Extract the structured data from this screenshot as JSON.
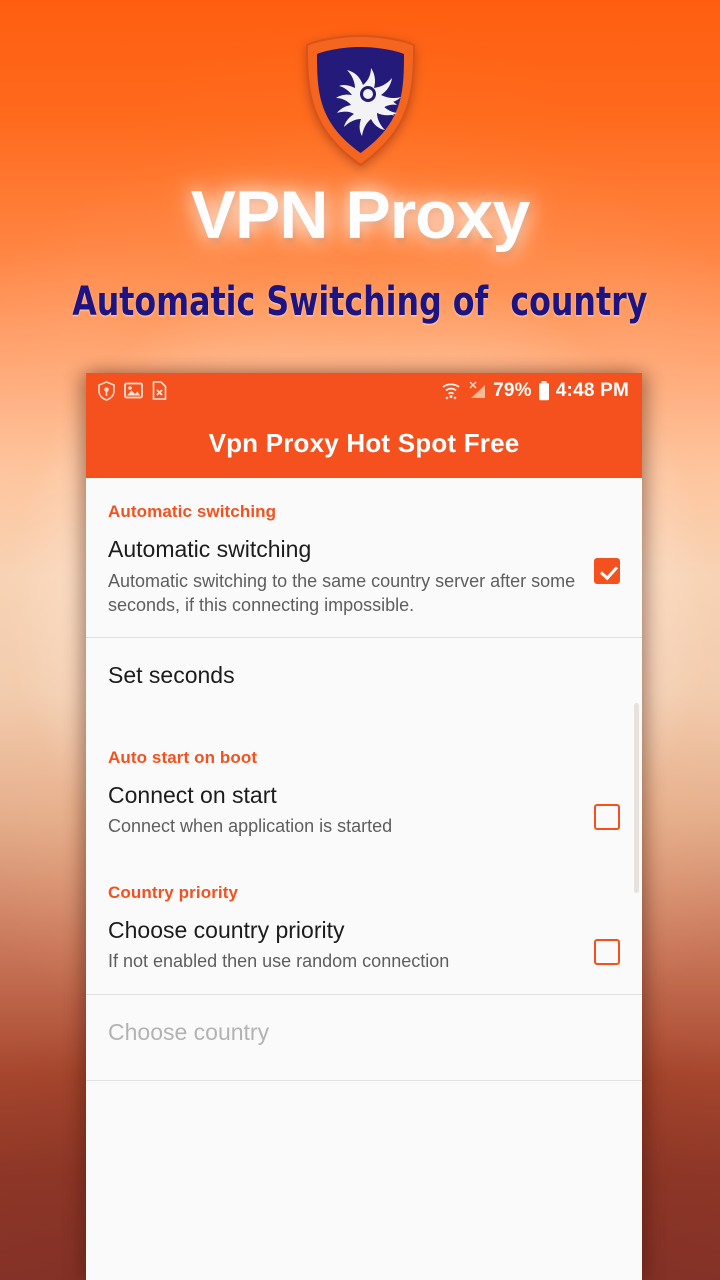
{
  "promo": {
    "app_title": "VPN Proxy",
    "tagline": "Automatic Switching of  country",
    "logo_icon": "shield-dragon-logo",
    "accent_color": "#f4511e",
    "tagline_color": "#1d1482"
  },
  "phone": {
    "status_bar": {
      "left_icons": [
        "shield-icon",
        "image-icon",
        "file-error-icon"
      ],
      "wifi_icon": "wifi-icon",
      "signal_icon": "signal-no-service-icon",
      "battery_percent": "79%",
      "battery_icon": "battery-icon",
      "time": "4:48 PM"
    },
    "app_bar": {
      "title": "Vpn Proxy Hot Spot Free"
    },
    "sections": [
      {
        "header": "Automatic switching",
        "rows": [
          {
            "title": "Automatic switching",
            "subtitle": "Automatic switching to the same country server after some seconds, if this connecting impossible.",
            "checkbox": "checked"
          }
        ]
      },
      {
        "header": "",
        "rows": [
          {
            "title": "Set seconds",
            "subtitle": "",
            "checkbox": "none"
          }
        ]
      },
      {
        "header": "Auto start on boot",
        "rows": [
          {
            "title": "Connect on start",
            "subtitle": "Connect when application is started",
            "checkbox": "unchecked"
          }
        ]
      },
      {
        "header": "Country priority",
        "rows": [
          {
            "title": "Choose country priority",
            "subtitle": "If not enabled then use random connection",
            "checkbox": "unchecked"
          }
        ]
      },
      {
        "header": "",
        "rows": [
          {
            "title": "Choose country",
            "subtitle": "",
            "checkbox": "none"
          }
        ]
      }
    ]
  }
}
